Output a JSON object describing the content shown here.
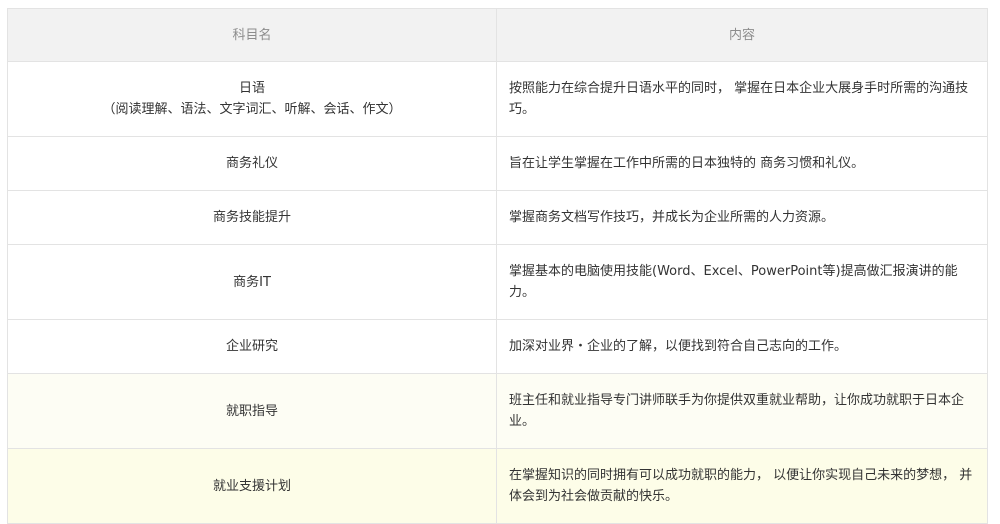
{
  "table": {
    "headers": [
      "科目名",
      "内容"
    ],
    "rows": [
      {
        "name": "日语",
        "name_sub": "（阅读理解、语法、文字词汇、听解、会话、作文）",
        "desc": "按照能力在综合提升日语水平的同时， 掌握在日本企业大展身手时所需的沟通技巧。"
      },
      {
        "name": "商务礼仪",
        "desc": "旨在让学生掌握在工作中所需的日本独特的 商务习惯和礼仪。"
      },
      {
        "name": "商务技能提升",
        "desc": "掌握商务文档写作技巧，并成长为企业所需的人力资源。"
      },
      {
        "name": "商务IT",
        "desc": "掌握基本的电脑使用技能(Word、Excel、PowerPoint等)提高做汇报演讲的能力。"
      },
      {
        "name": "企业研究",
        "desc": "加深对业界・企业的了解，以便找到符合自己志向的工作。"
      },
      {
        "name": "就职指导",
        "desc": "班主任和就业指导专门讲师联手为你提供双重就业帮助，让你成功就职于日本企业。"
      },
      {
        "name": "就业支援计划",
        "desc": "在掌握知识的同时拥有可以成功就职的能力， 以便让你实现自己未来的梦想， 并体会到为社会做贡献的快乐。"
      }
    ]
  }
}
